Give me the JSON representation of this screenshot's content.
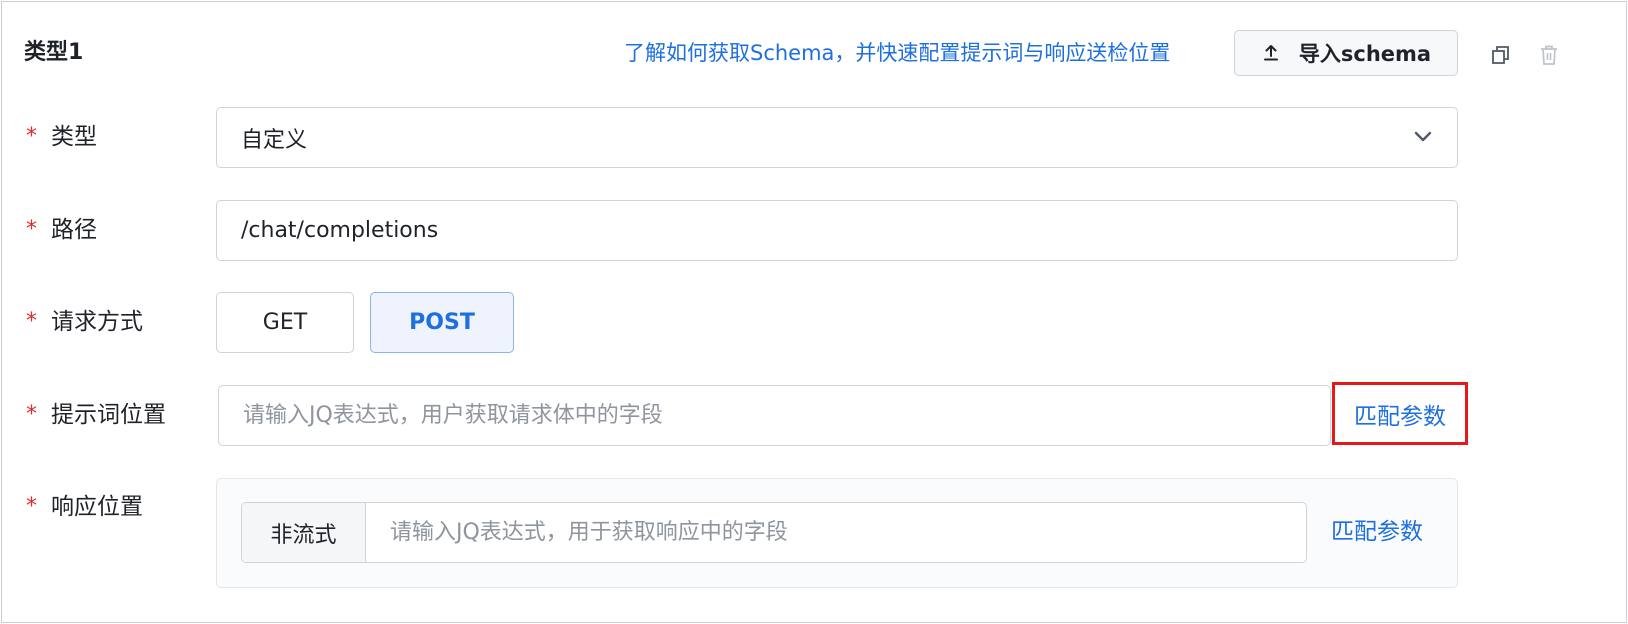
{
  "header": {
    "title": "类型1",
    "help_link": "了解如何获取Schema，并快速配置提示词与响应送检位置",
    "import_button": "导入schema"
  },
  "form": {
    "required_mark": "*",
    "type": {
      "label": "类型",
      "value": "自定义"
    },
    "path": {
      "label": "路径",
      "value": "/chat/completions"
    },
    "method": {
      "label": "请求方式",
      "options": [
        "GET",
        "POST"
      ],
      "selected": "POST"
    },
    "prompt_position": {
      "label": "提示词位置",
      "placeholder": "请输入JQ表达式，用户获取请求体中的字段",
      "match_link": "匹配参数"
    },
    "response_position": {
      "label": "响应位置",
      "mode": "非流式",
      "placeholder": "请输入JQ表达式，用于获取响应中的字段",
      "match_link": "匹配参数"
    }
  },
  "icons": {
    "import": "upload-icon",
    "copy": "copy-icon",
    "delete": "trash-icon",
    "dropdown": "chevron-down-icon"
  },
  "colors": {
    "accent": "#1e6fe0",
    "required": "#e02e2e",
    "highlight_box": "#e31a1a",
    "selected_bg": "#eef3fe"
  }
}
